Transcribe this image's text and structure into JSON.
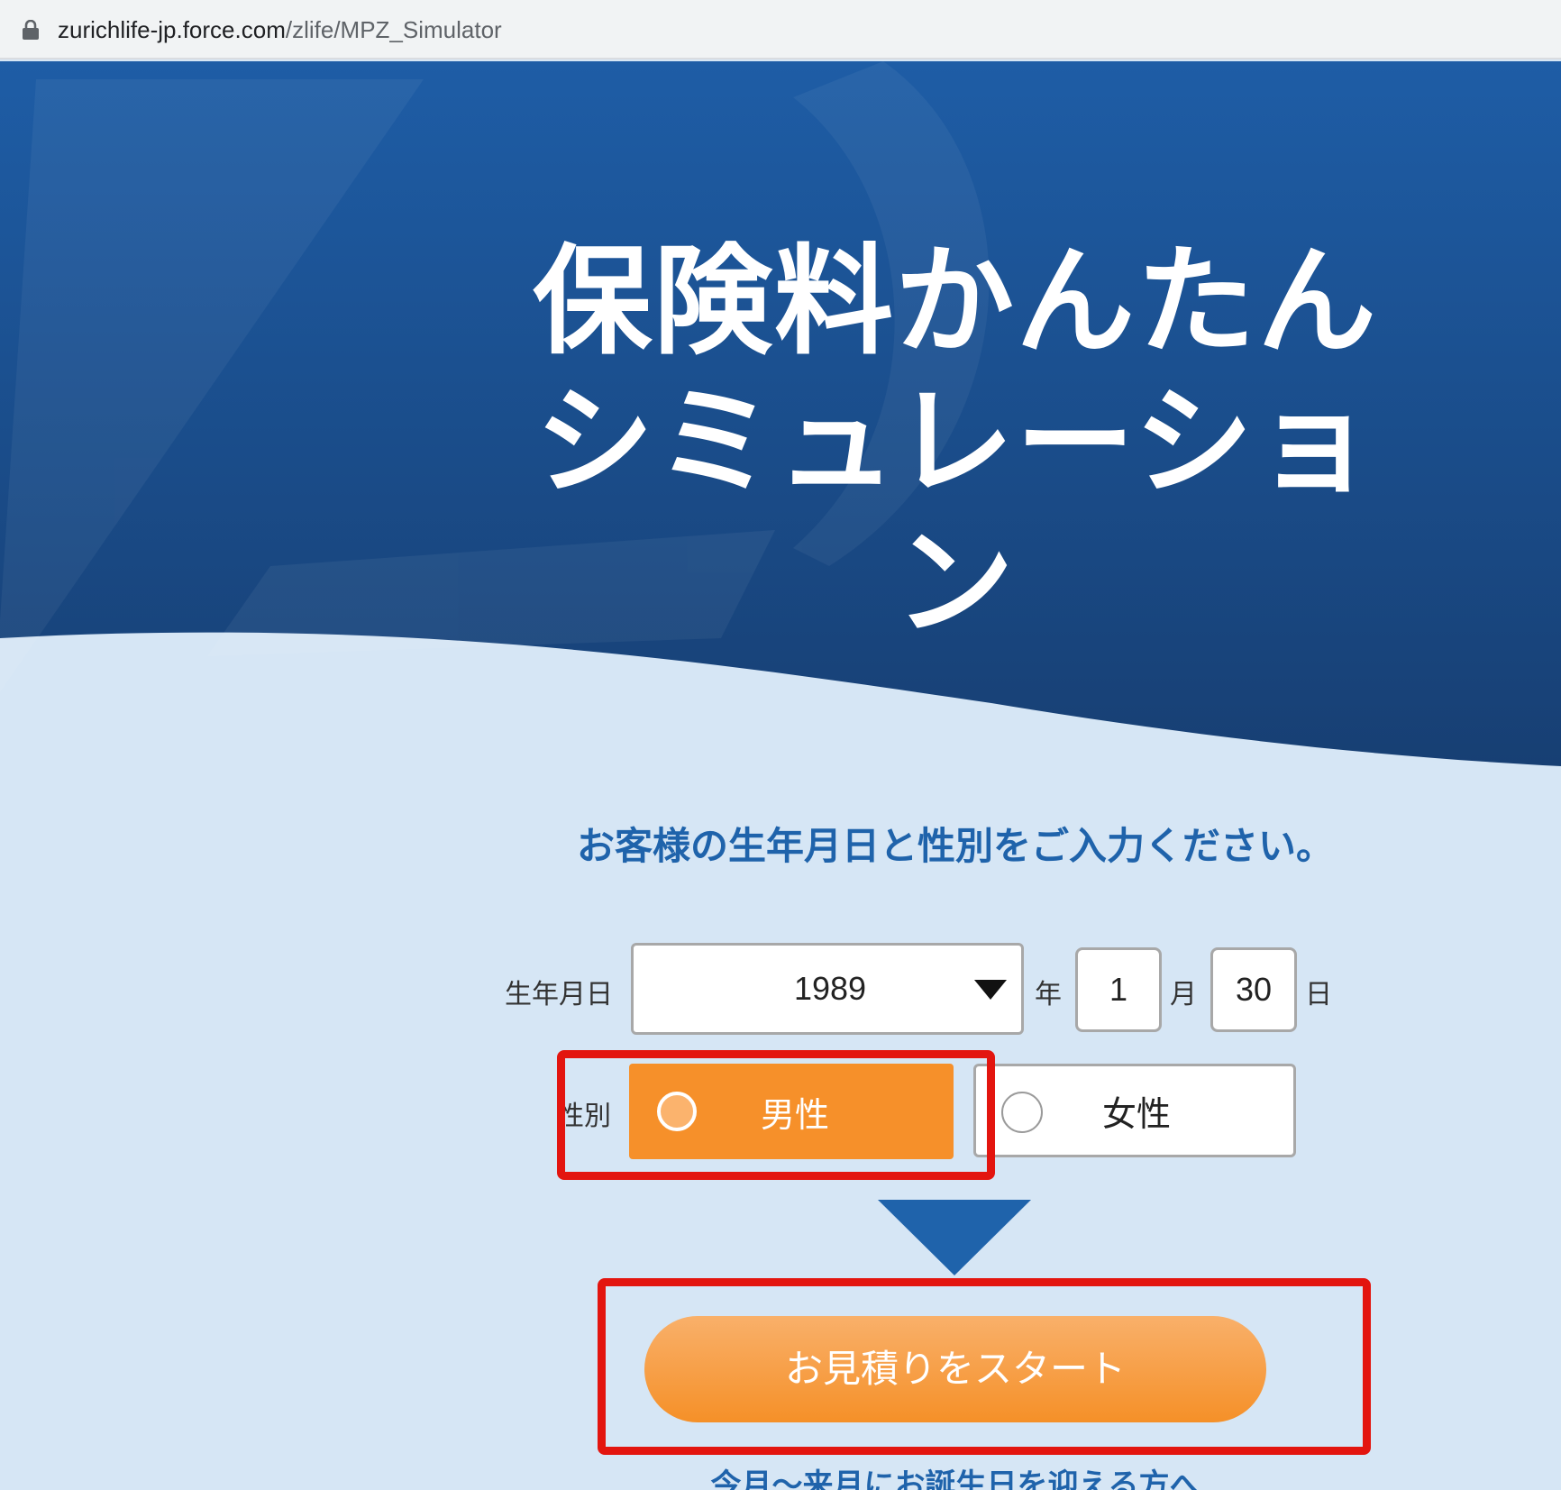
{
  "browser": {
    "url_host": "zurichlife-jp.force.com",
    "url_path": "/zlife/MPZ_Simulator"
  },
  "hero": {
    "title_line1": "保険料かんたん",
    "title_line2": "シミュレーション"
  },
  "form": {
    "prompt": "お客様の生年月日と性別をご入力ください。",
    "birthdate_label": "生年月日",
    "year_value": "1989",
    "year_unit": "年",
    "month_value": "1",
    "month_unit": "月",
    "day_value": "30",
    "day_unit": "日",
    "gender_label": "性別",
    "gender_options": [
      "男性",
      "女性"
    ],
    "selected_gender": "男性"
  },
  "actions": {
    "start_button": "お見積りをスタート",
    "birthday_link": "今月〜来月にお誕生日を迎える方へ"
  },
  "colors": {
    "brand_blue": "#1f63ab",
    "accent_orange": "#f6902a",
    "highlight_red": "#e3150f",
    "page_bg": "#d6e6f5"
  }
}
